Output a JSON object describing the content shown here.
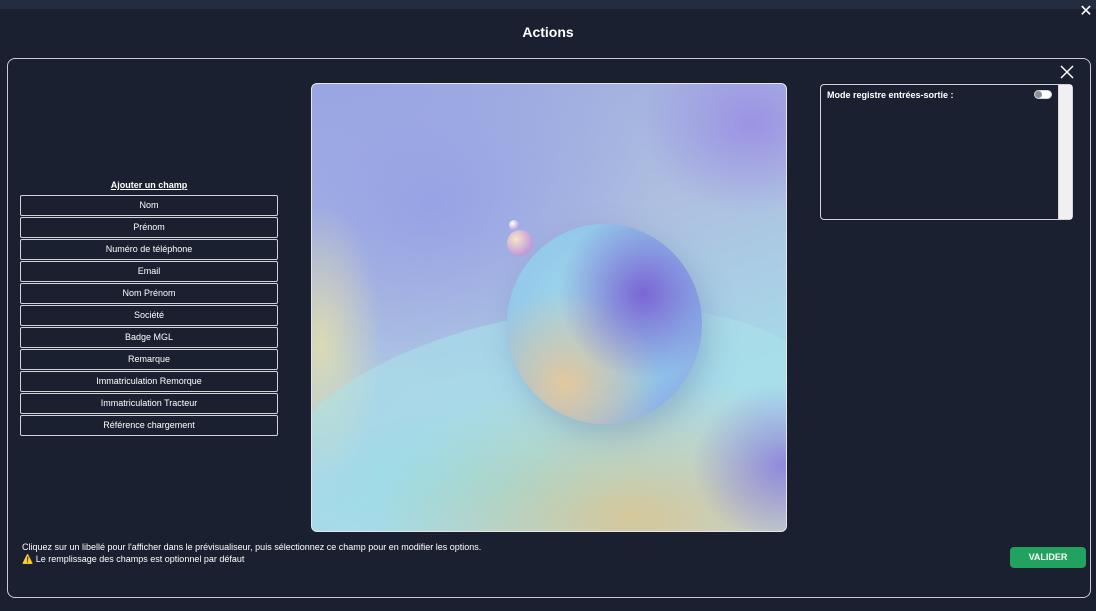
{
  "modal": {
    "title": "Actions",
    "close_icon": "close-icon"
  },
  "fields": {
    "title": "Ajouter un champ",
    "items": [
      {
        "label": "Nom"
      },
      {
        "label": "Prénom"
      },
      {
        "label": "Numéro de téléphone"
      },
      {
        "label": "Email"
      },
      {
        "label": "Nom Prénom"
      },
      {
        "label": "Société"
      },
      {
        "label": "Badge MGL"
      },
      {
        "label": "Remarque"
      },
      {
        "label": "Immatriculation Remorque"
      },
      {
        "label": "Immatriculation Tracteur"
      },
      {
        "label": "Référence chargement"
      }
    ]
  },
  "options": {
    "mode_label": "Mode registre entrées-sortie :",
    "mode_enabled": false
  },
  "help": {
    "line1": "Cliquez sur un libellé pour l'afficher dans le prévisualiseur, puis sélectionnez ce champ pour en modifier les options.",
    "warning_icon": "⚠️",
    "line2": "Le remplissage des champs est optionnel par défaut"
  },
  "actions": {
    "submit_label": "VALIDER"
  },
  "colors": {
    "background": "#1a2030",
    "accent_green": "#21a25e"
  }
}
